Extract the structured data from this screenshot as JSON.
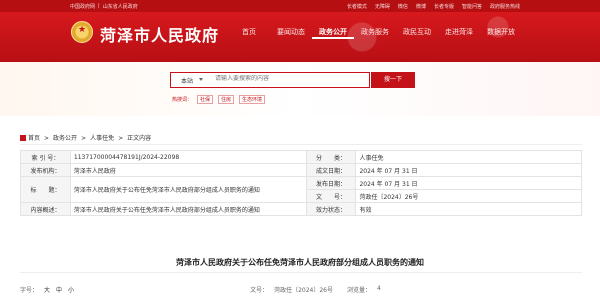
{
  "topbar": {
    "links_left": [
      "中国政府网",
      "|",
      "山东省人民政府"
    ],
    "links_right": [
      "长者模式",
      "无障碍",
      "微信",
      "微博",
      "长者专版",
      "智能问答",
      "政府服务热线"
    ]
  },
  "header": {
    "site_title": "菏泽市人民政府",
    "nav": [
      "首页",
      "要闻动态",
      "政务公开",
      "政务服务",
      "政民互动",
      "走进菏泽",
      "数据开放"
    ],
    "active_nav": "政务公开"
  },
  "search": {
    "scope": "本站",
    "placeholder": "请输入要搜索的内容",
    "button": "搜一下",
    "hot_label": "热搜词：",
    "hot_tags": [
      "社保",
      "住房",
      "生态环境"
    ]
  },
  "breadcrumb": {
    "items": [
      "首页",
      "政务公开",
      "人事任免",
      "正文内容"
    ],
    "sep": ">"
  },
  "meta": {
    "rows": [
      {
        "k1": "索 引 号：",
        "v1": "11371700004478191J/2024-22098",
        "k2": "分　　类：",
        "v2": "人事任免"
      },
      {
        "k1": "发布机构：",
        "v1": "菏泽市人民政府",
        "k2": "成文日期：",
        "v2": "2024 年 07 月 31 日"
      },
      {
        "k1": "标　　题：",
        "v1": "菏泽市人民政府关于公布任免菏泽市人民政府部分组成人员职务的通知",
        "k2": "发布日期：",
        "v2": "2024 年 07 月 31 日"
      },
      {
        "k1": "",
        "v1": "",
        "k2": "文　　号：",
        "v2": "菏政任〔2024〕26号"
      },
      {
        "k1": "内容概述：",
        "v1": "菏泽市人民政府关于公布任免菏泽市人民政府部分组成人员职务的通知",
        "k2": "效力状态：",
        "v2": "有效"
      }
    ]
  },
  "article": {
    "title": "菏泽市人民政府关于公布任免菏泽市人民政府部分组成人员职务的通知",
    "font_label": "字号：",
    "font_sizes": [
      "大",
      "中",
      "小"
    ],
    "doc_no_label": "文号：",
    "doc_no": "菏政任〔2024〕26号",
    "views_label": "浏览量：",
    "views": "4"
  }
}
